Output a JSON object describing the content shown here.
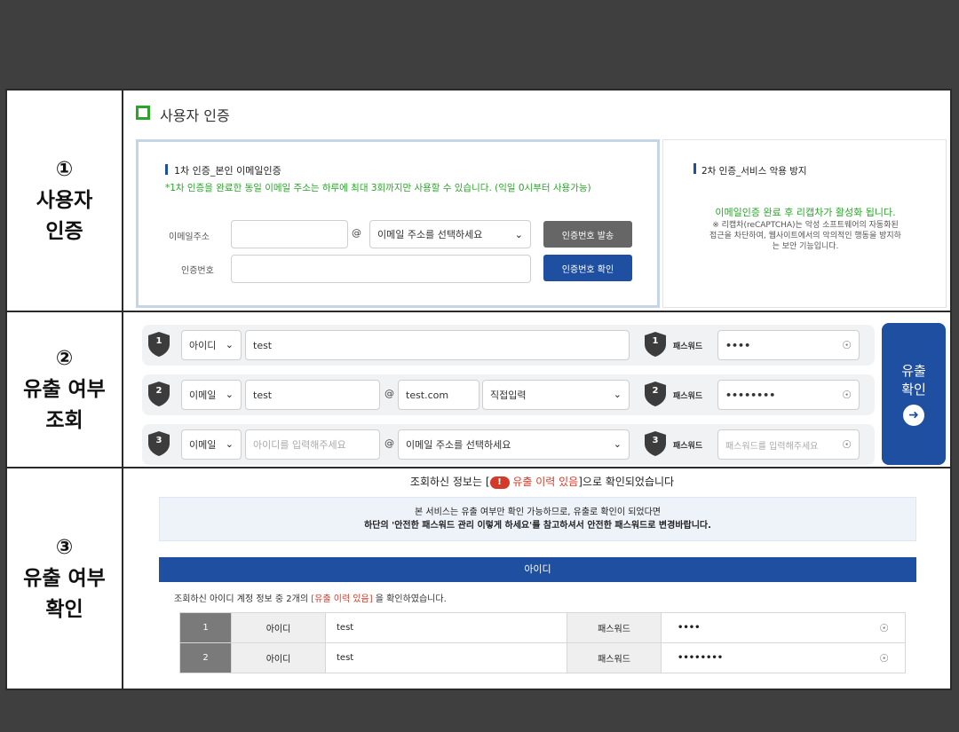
{
  "colors": {
    "accent_green": "#2aa52a",
    "brand_blue": "#1f4fa0",
    "danger_red": "#d23b2b",
    "dark_gray": "#666666"
  },
  "rows": [
    {
      "number": "①",
      "line1": "사용자",
      "line2": "인증"
    },
    {
      "number": "②",
      "line1": "유출 여부",
      "line2": "조회"
    },
    {
      "number": "③",
      "line1": "유출 여부",
      "line2": "확인"
    }
  ],
  "auth": {
    "title": "사용자 인증",
    "step1_title": "1차 인증_본인 이메일인증",
    "step1_note": "*1차 인증을 완료한 동일 이메일 주소는 하루에 최대 3회까지만 사용할 수 있습니다. (익일 0시부터 사용가능)",
    "email_label": "이메일주소",
    "at_symbol": "@",
    "email_domain_placeholder": "이메일 주소를 선택하세요",
    "send_code_button": "인증번호 발송",
    "code_label": "인증번호",
    "verify_code_button": "인증번호 확인",
    "step2_title": "2차 인증_서비스 악용 방지",
    "step2_highlight": "이메일인증 완료 후 리캡차가 활성화 됩니다.",
    "step2_note": "※ 리캡차(reCAPTCHA)는 악성 소프트웨어의 자동화된 접근을 차단하여, 웹사이트에서의 악의적인 행동을 방지하는 보안 기능입니다."
  },
  "lookup": {
    "submit_line1": "유출",
    "submit_line2": "확인",
    "password_label": "패스워드",
    "rows": [
      {
        "num": "1",
        "type": "아이디",
        "id_value": "test",
        "domain_value": "",
        "domain_select": "",
        "password": "••••"
      },
      {
        "num": "2",
        "type": "이메일",
        "id_value": "test",
        "at": "@",
        "domain_value": "test.com",
        "domain_select": "직접입력",
        "password": "••••••••"
      },
      {
        "num": "3",
        "type": "이메일",
        "id_placeholder": "아이디를 입력해주세요",
        "at": "@",
        "domain_select": "이메일 주소를 선택하세요",
        "password_placeholder": "패스워드를 입력해주세요"
      }
    ]
  },
  "result": {
    "headline_pre": "조회하신 정보는 [",
    "headline_alert": "!",
    "headline_status": "유출 이력 있음",
    "headline_post": "]으로 확인되었습니다",
    "notice_line1": "본 서비스는 유출 여부만 확인 가능하므로, 유출로 확인이 되었다면",
    "notice_line2": "하단의 '안전한 패스워드 관리 이렇게 하세요'를 참고하셔서 안전한 패스워드로 변경바랍니다.",
    "tab_label": "아이디",
    "summary_pre": "조회하신 아이디 계정 정보 중 2개의 ",
    "summary_status": "[유출 이력 있음]",
    "summary_post": " 을 확인하였습니다.",
    "table": [
      {
        "num": "1",
        "type": "아이디",
        "value": "test",
        "pw_label": "패스워드",
        "pw": "••••"
      },
      {
        "num": "2",
        "type": "아이디",
        "value": "test",
        "pw_label": "패스워드",
        "pw": "••••••••"
      }
    ]
  }
}
